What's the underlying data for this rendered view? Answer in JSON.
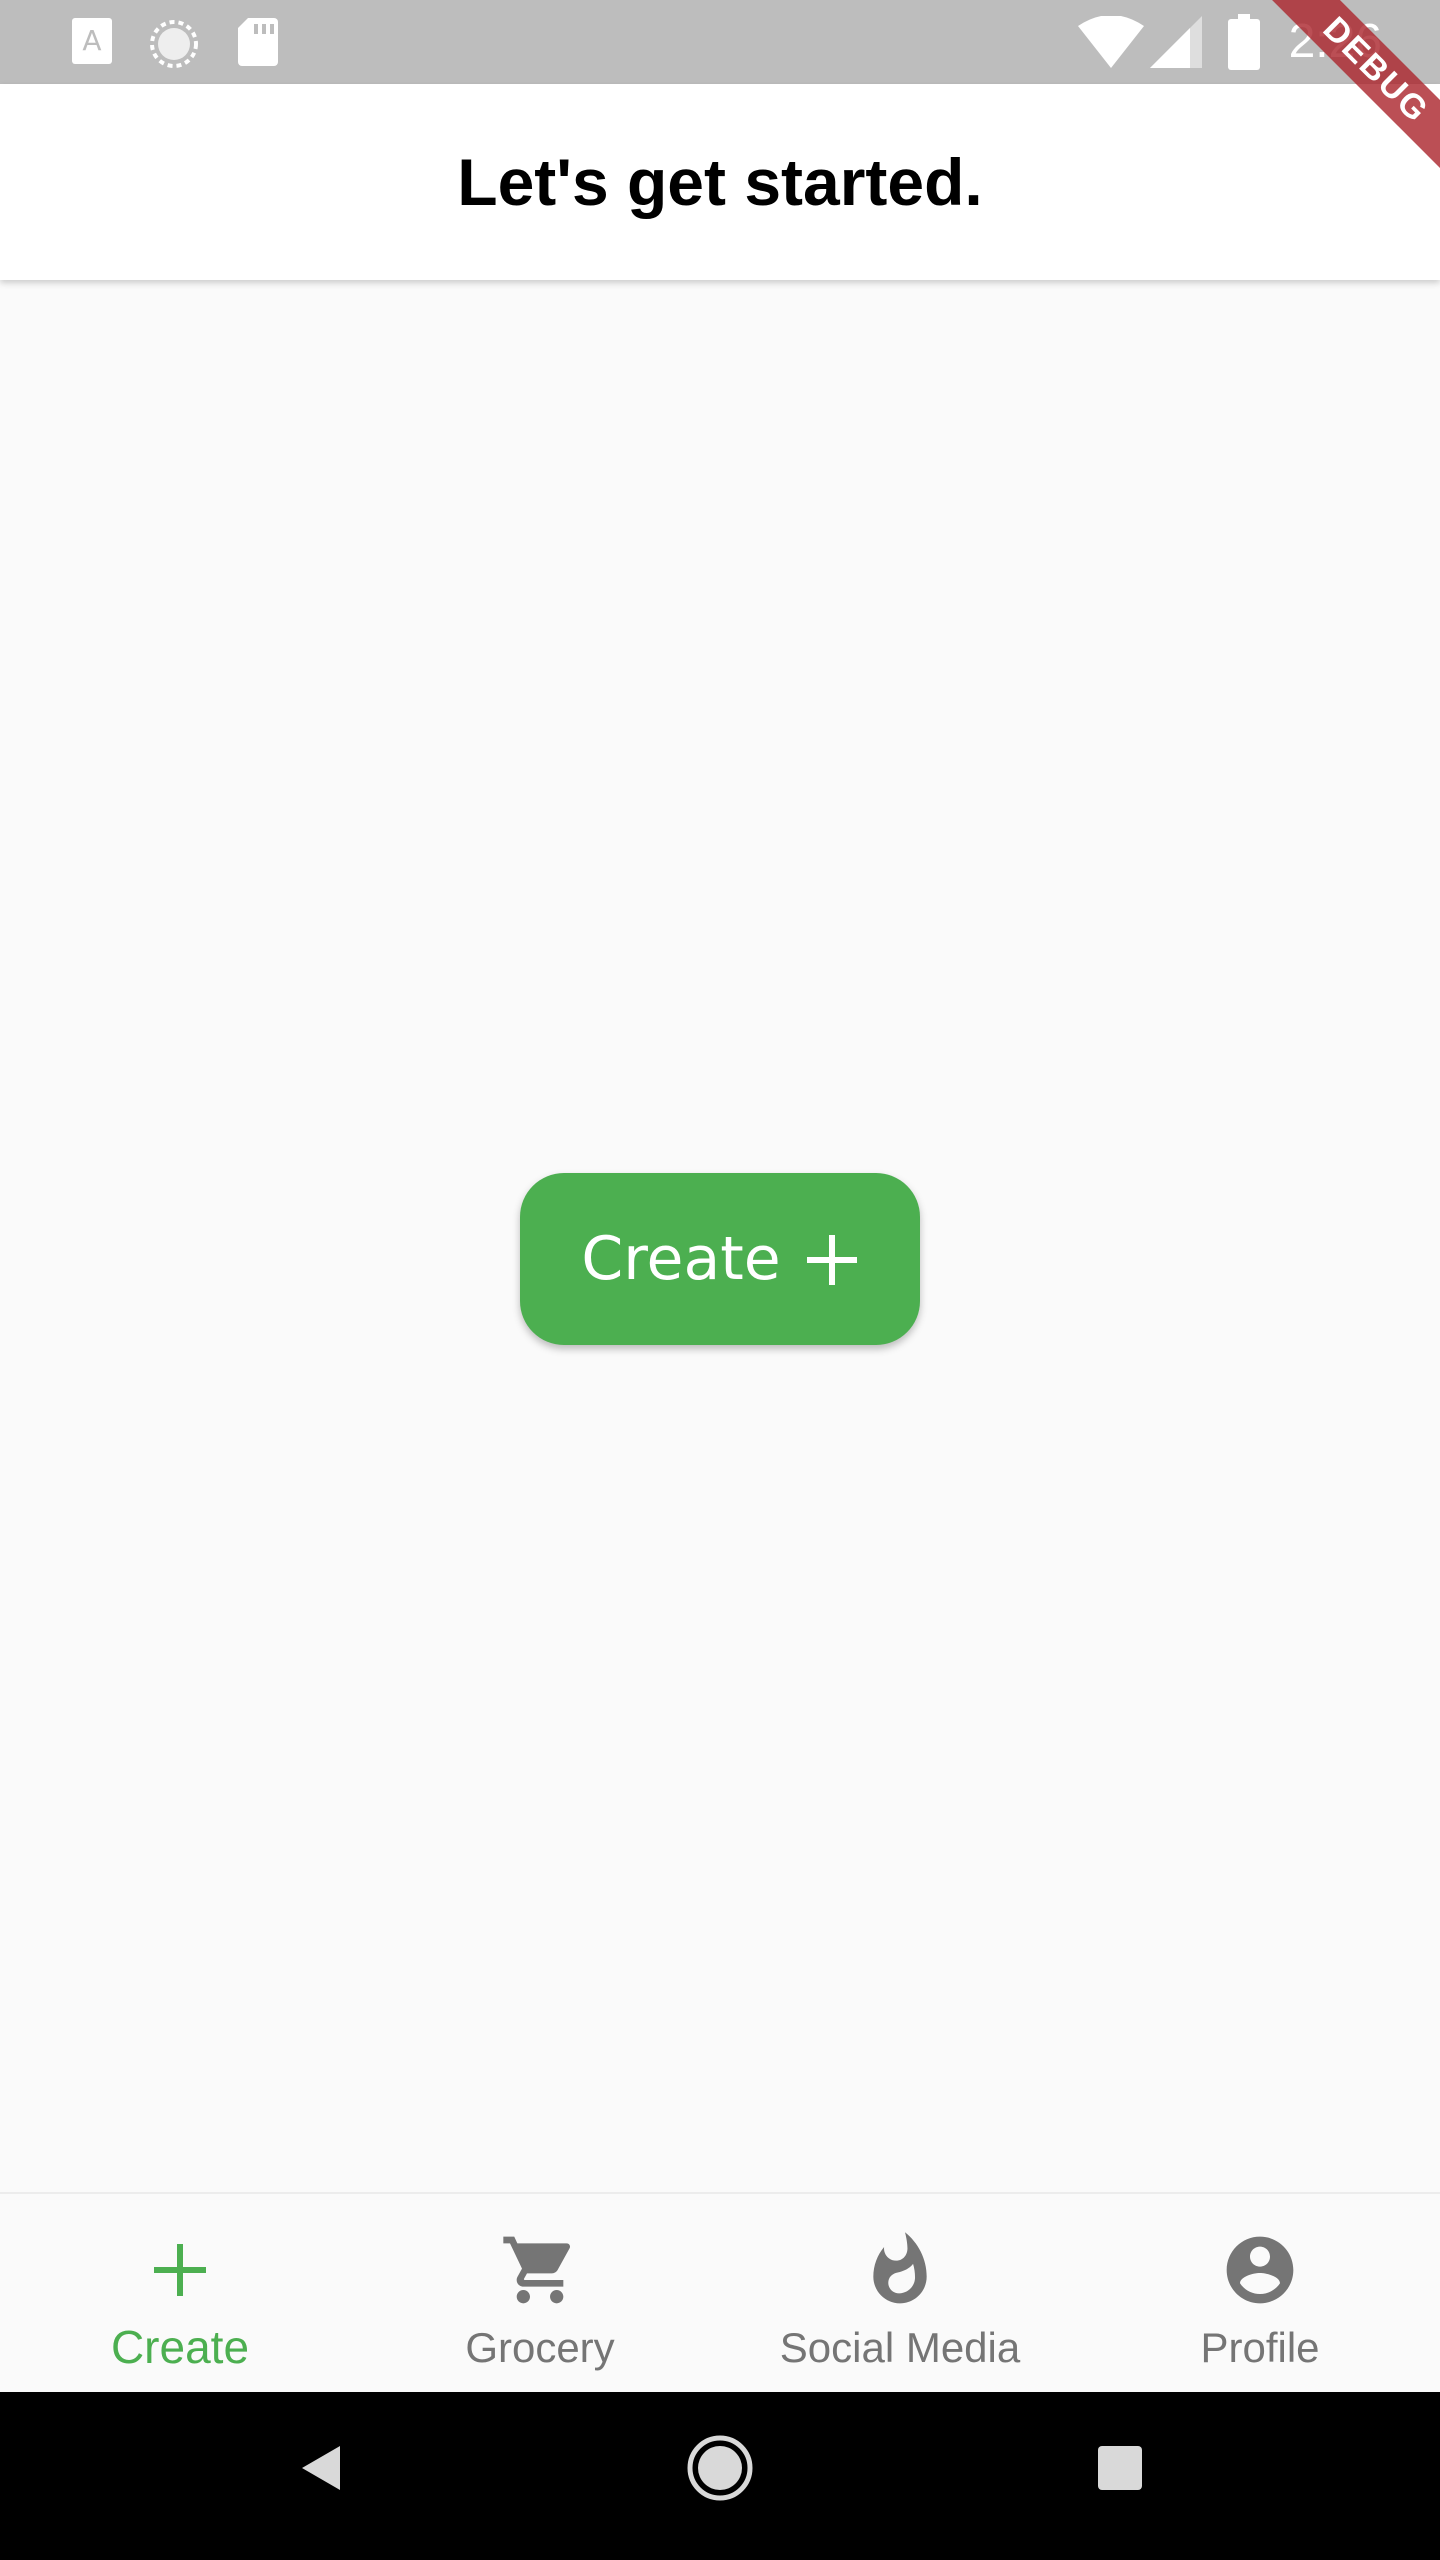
{
  "status_bar": {
    "time": "2:26",
    "left_icons": [
      "text-a-icon",
      "sync-circle-icon",
      "sd-card-icon"
    ],
    "right_icons": [
      "wifi-icon",
      "cellular-signal-icon",
      "battery-icon"
    ]
  },
  "debug_banner": {
    "label": "DEBUG"
  },
  "app_bar": {
    "title": "Let's get started."
  },
  "main": {
    "create_button": {
      "label": "Create",
      "icon": "plus-icon"
    }
  },
  "bottom_nav": {
    "active_color": "#4caf50",
    "inactive_color": "#757575",
    "items": [
      {
        "label": "Create",
        "icon": "plus-icon",
        "active": true
      },
      {
        "label": "Grocery",
        "icon": "cart-icon",
        "active": false
      },
      {
        "label": "Social Media",
        "icon": "flame-icon",
        "active": false
      },
      {
        "label": "Profile",
        "icon": "account-circle-icon",
        "active": false
      }
    ]
  },
  "system_nav": {
    "buttons": [
      "back-icon",
      "home-icon",
      "recents-icon"
    ]
  },
  "colors": {
    "accent": "#4caf50",
    "status_bar": "#bdbdbd",
    "background": "#fafafa",
    "debug_banner": "#ac2830"
  }
}
